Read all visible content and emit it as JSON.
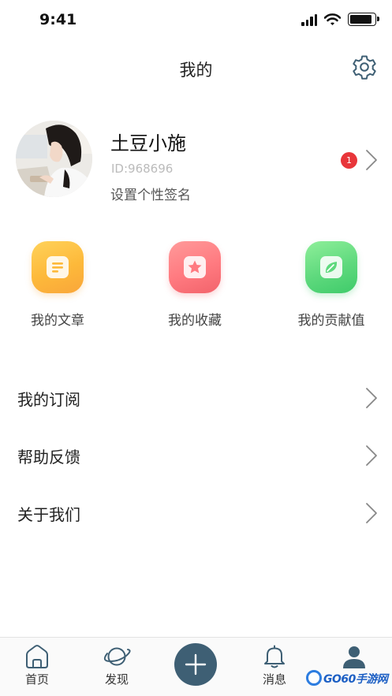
{
  "status_bar": {
    "time": "9:41",
    "icons": [
      "signal-icon",
      "wifi-icon",
      "battery-icon"
    ],
    "battery_level": 0.9
  },
  "nav": {
    "title": "我的",
    "settings_icon": "gear-icon"
  },
  "profile": {
    "name": "土豆小施",
    "id_text": "ID:968696",
    "signature": "设置个性签名",
    "badge_count": "1"
  },
  "quick_actions": [
    {
      "label": "我的文章",
      "icon": "article-icon",
      "color": "#fdb93a"
    },
    {
      "label": "我的收藏",
      "icon": "star-icon",
      "color": "#ff7a80"
    },
    {
      "label": "我的贡献值",
      "icon": "contribution-icon",
      "color": "#5ed97d"
    }
  ],
  "menu": [
    {
      "label": "我的订阅"
    },
    {
      "label": "帮助反馈"
    },
    {
      "label": "关于我们"
    }
  ],
  "tab_bar": {
    "tabs": [
      {
        "label": "首页",
        "icon": "home-icon"
      },
      {
        "label": "发现",
        "icon": "planet-icon"
      },
      {
        "label": "",
        "icon": "plus-icon"
      },
      {
        "label": "消息",
        "icon": "bell-icon"
      },
      {
        "label": "",
        "icon": "user-icon"
      }
    ],
    "accent": "#3e5f74"
  },
  "watermark": {
    "text": "GO60手游网"
  }
}
